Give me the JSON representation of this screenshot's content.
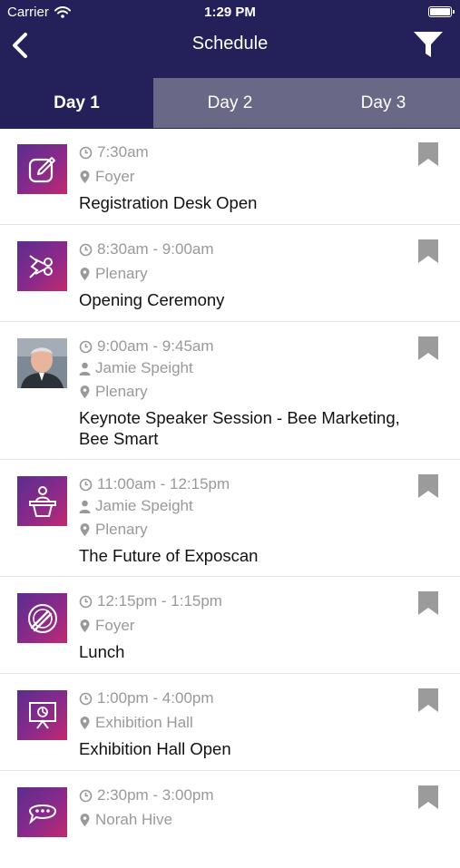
{
  "status_bar": {
    "carrier": "Carrier",
    "time": "1:29 PM"
  },
  "nav": {
    "title": "Schedule"
  },
  "tabs": [
    {
      "label": "Day 1",
      "active": true
    },
    {
      "label": "Day 2",
      "active": false
    },
    {
      "label": "Day 3",
      "active": false
    }
  ],
  "sessions": [
    {
      "time": "7:30am",
      "location": "Foyer",
      "title": "Registration Desk Open",
      "icon": "pencil-form-icon"
    },
    {
      "time": "8:30am - 9:00am",
      "location": "Plenary",
      "title": "Opening Ceremony",
      "icon": "ribbon-cutting-icon"
    },
    {
      "time": "9:00am - 9:45am",
      "speaker": "Jamie Speight",
      "location": "Plenary",
      "title_line1": "Keynote Speaker Session - Bee Marketing,",
      "title_line2": "Bee Smart",
      "icon": "speaker-photo"
    },
    {
      "time": "11:00am - 12:15pm",
      "speaker": "Jamie Speight",
      "location": "Plenary",
      "title": "The Future of Exposcan",
      "icon": "podium-speaker-icon"
    },
    {
      "time": "12:15pm - 1:15pm",
      "location": "Foyer",
      "title": "Lunch",
      "icon": "plate-cutlery-icon"
    },
    {
      "time": "1:00pm - 4:00pm",
      "location": "Exhibition Hall",
      "title": "Exhibition Hall Open",
      "icon": "presentation-board-icon"
    },
    {
      "time": "2:30pm - 3:00pm",
      "location": "Norah Hive",
      "icon": "chat-bubble-icon"
    }
  ],
  "colors": {
    "header": "#24205a",
    "tab_inactive": "#6a6887",
    "meta_text": "#999999",
    "bookmark": "#9b9b9b",
    "thumb_gradient": [
      "#5b2d8e",
      "#c12a6f"
    ]
  }
}
